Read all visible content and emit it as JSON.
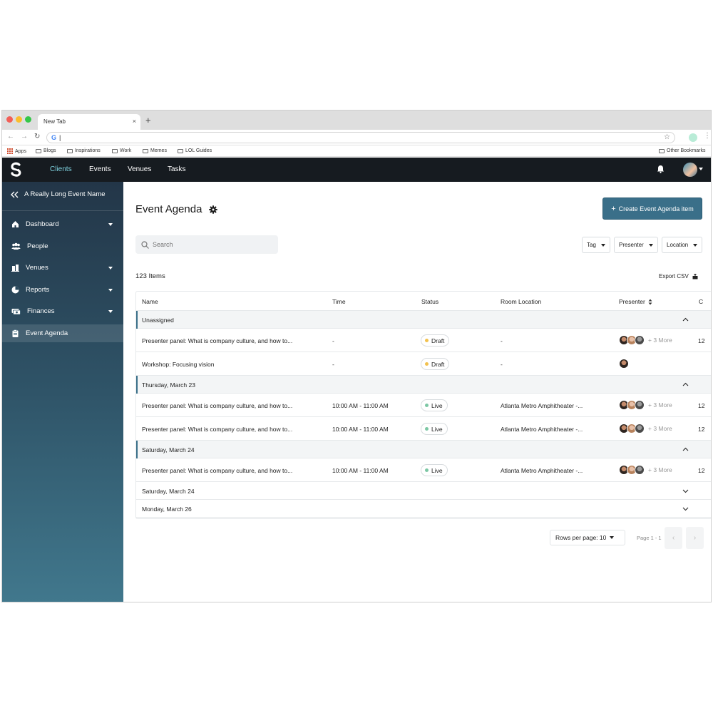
{
  "browser": {
    "tab_title": "New Tab",
    "tab_close": "×",
    "new_tab": "+",
    "omnibox_value": "",
    "bookmarks": [
      "Apps",
      "Blogs",
      "Inspirations",
      "Work",
      "Memes",
      "LOL Guides"
    ],
    "other_bookmarks": "Other Bookmarks"
  },
  "appbar": {
    "nav": [
      "Clients",
      "Events",
      "Venues",
      "Tasks"
    ],
    "active_nav": "Clients",
    "accent": "#7fd3e0"
  },
  "sidebar": {
    "event_name": "A Really Long Event Name",
    "items": [
      {
        "label": "Dashboard",
        "icon": "home-icon",
        "caret": true
      },
      {
        "label": "People",
        "icon": "people-icon",
        "caret": false
      },
      {
        "label": "Venues",
        "icon": "building-icon",
        "caret": true
      },
      {
        "label": "Reports",
        "icon": "pie-chart-icon",
        "caret": true
      },
      {
        "label": "Finances",
        "icon": "money-icon",
        "caret": true
      },
      {
        "label": "Event Agenda",
        "icon": "clipboard-icon",
        "caret": false,
        "active": true
      }
    ]
  },
  "main": {
    "title": "Event Agenda",
    "create_button": "Create Event Agenda item",
    "search_placeholder": "Search",
    "filters": [
      "Tag",
      "Presenter",
      "Location"
    ],
    "item_count": "123 Items",
    "export_label": "Export CSV"
  },
  "table": {
    "columns": [
      "Name",
      "Time",
      "Status",
      "Room Location",
      "Presenter"
    ],
    "truncated_column": "C",
    "groups": [
      {
        "label": "Unassigned",
        "expanded": true
      },
      {
        "label": "Thursday, March 23",
        "expanded": true
      },
      {
        "label": "Saturday, March 24",
        "expanded": true
      },
      {
        "label": "Saturday, March 24",
        "expanded": false
      },
      {
        "label": "Monday, March 26",
        "expanded": false
      }
    ],
    "rows": [
      {
        "name": "Presenter panel: What is company culture, and how to...",
        "time": "-",
        "status": "Draft",
        "location": "-",
        "more": "+ 3 More",
        "trunc": "12"
      },
      {
        "name": "Workshop: Focusing vision",
        "time": "-",
        "status": "Draft",
        "location": "-",
        "more": "",
        "trunc": ""
      },
      {
        "name": "Presenter panel: What is company culture, and how to...",
        "time": "10:00 AM - 11:00 AM",
        "status": "Live",
        "location": "Atlanta Metro Amphitheater -...",
        "more": "+ 3 More",
        "trunc": "12"
      },
      {
        "name": "Presenter panel: What is company culture, and how to...",
        "time": "10:00 AM - 11:00 AM",
        "status": "Live",
        "location": "Atlanta Metro Amphitheater -...",
        "more": "+ 3 More",
        "trunc": "12"
      },
      {
        "name": "Presenter panel: What is company culture, and how to...",
        "time": "10:00 AM - 11:00 AM",
        "status": "Live",
        "location": "Atlanta Metro Amphitheater -...",
        "more": "+ 3 More",
        "trunc": "12"
      }
    ],
    "status_colors": {
      "Draft": "#f2c14e",
      "Live": "#7cc7a4"
    }
  },
  "pagination": {
    "rows_per_page": "Rows per page: 10",
    "page_info": "Page 1 - 1"
  },
  "colors": {
    "primary": "#3a6f89",
    "appbar": "#161b20"
  }
}
